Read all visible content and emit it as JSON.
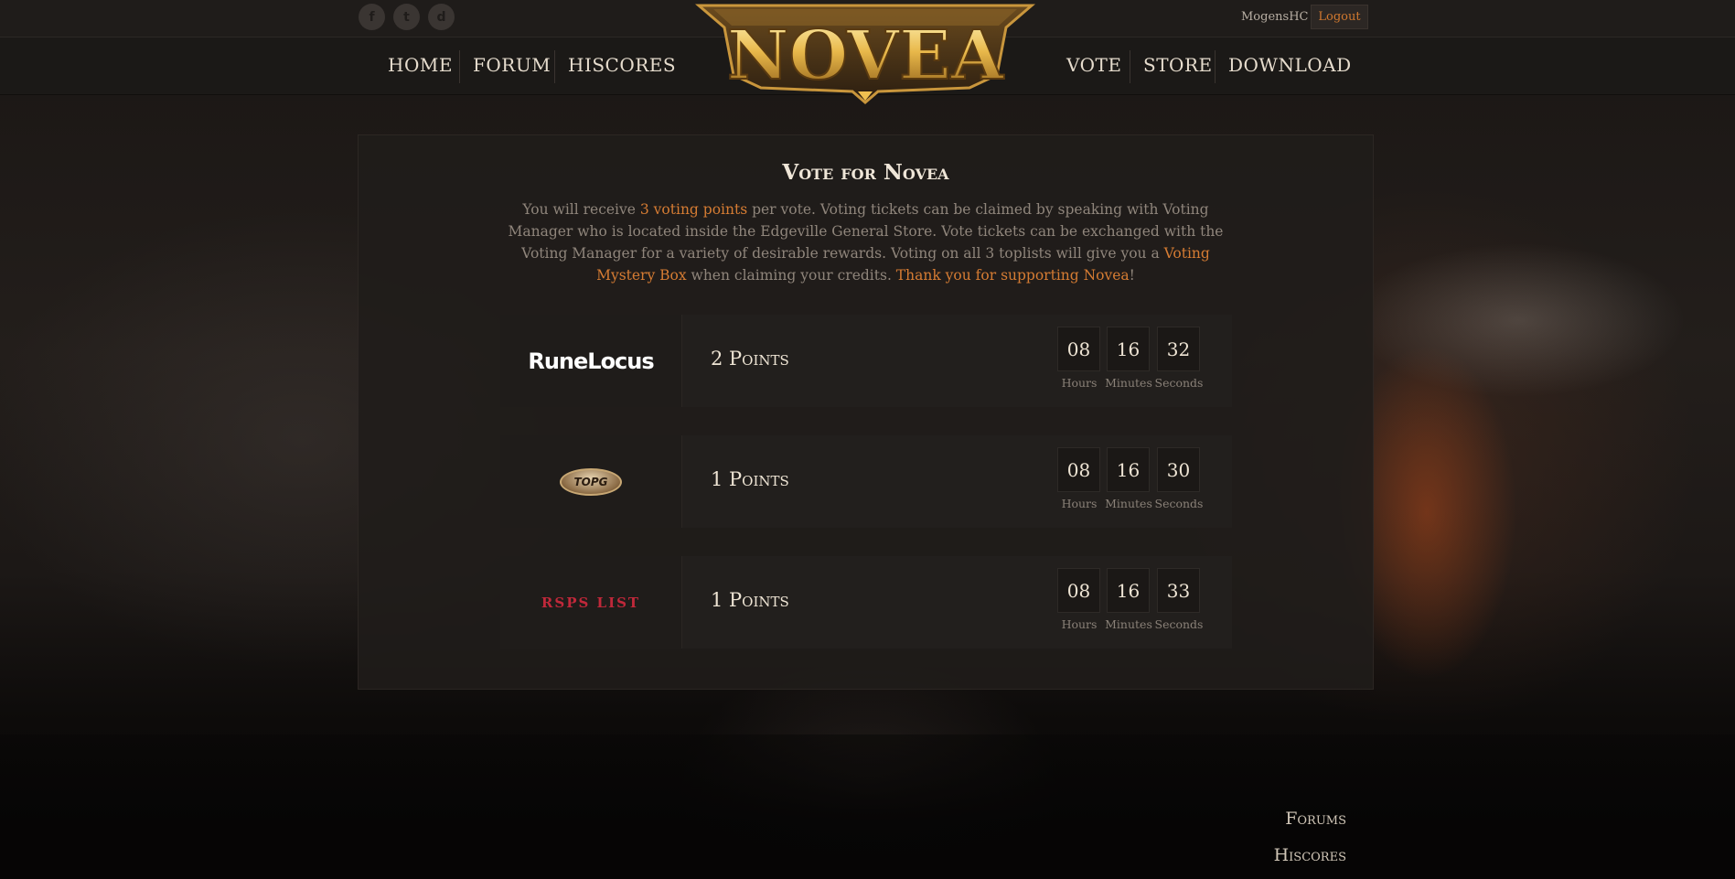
{
  "brand": {
    "logo_text": "NOVEA",
    "colors": {
      "accent": "#d67c33",
      "gold": "#e8b84a",
      "text_light": "#eee4d4"
    }
  },
  "topbar": {
    "social": [
      {
        "name": "facebook-icon",
        "glyph": "f"
      },
      {
        "name": "twitter-icon",
        "glyph": "t"
      },
      {
        "name": "discord-icon",
        "glyph": "d"
      }
    ],
    "username": "MogensHC",
    "logout_label": "Logout"
  },
  "nav": {
    "left": [
      "HOME",
      "FORUM",
      "HISCORES"
    ],
    "right": [
      "VOTE",
      "STORE",
      "DOWNLOAD"
    ]
  },
  "vote": {
    "title": "Vote for Novea",
    "intro": {
      "p1": "You will receive ",
      "hl1": "3 voting points",
      "p2": " per vote. Voting tickets can be claimed by speaking with Voting Manager who is located inside the Edgeville General Store. Vote tickets can be exchanged with the Voting Manager for a variety of desirable rewards. Voting on all 3 toplists will give you a ",
      "hl2": "Voting Mystery Box",
      "p3": " when claiming your credits. ",
      "hl3": "Thank you for supporting Novea",
      "p4": "!"
    },
    "sites": [
      {
        "logo": "RuneLocus",
        "points": "2 Points",
        "hours": "08",
        "minutes": "16",
        "seconds": "32"
      },
      {
        "logo": "TOPG",
        "points": "1 Points",
        "hours": "08",
        "minutes": "16",
        "seconds": "30"
      },
      {
        "logo": "RSPS LIST",
        "points": "1 Points",
        "hours": "08",
        "minutes": "16",
        "seconds": "33"
      }
    ],
    "timer_labels": {
      "hours": "Hours",
      "minutes": "Minutes",
      "seconds": "Seconds"
    }
  },
  "footer": {
    "links": [
      "Forums",
      "Hiscores"
    ]
  }
}
